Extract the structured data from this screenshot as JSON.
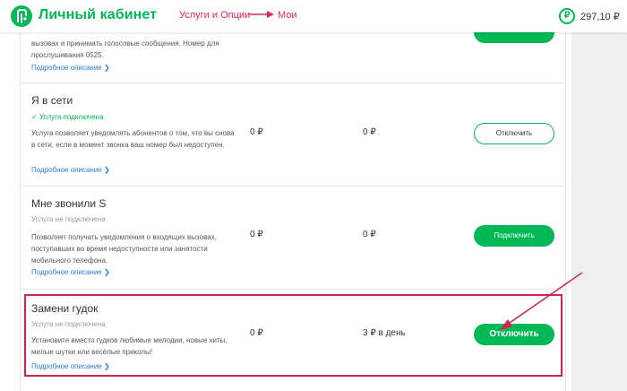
{
  "header": {
    "brand": "Личный кабинет",
    "crumb_1": "Услуги и Опции",
    "crumb_2": "Мои",
    "balance": "297,10 ₽",
    "currency_symbol": "₽",
    "accent_color": "#00b956",
    "annotation_color": "#e0245e"
  },
  "services": [
    {
      "title": "",
      "status": "",
      "description": "вызовах и принимать голосовые сообщения. Номер для прослушивания 0525.",
      "more_link": "Подробное описание ❯",
      "price_1": "",
      "price_2": "",
      "button": ""
    },
    {
      "title": "Я в сети",
      "status": "✓ Услуга подключена",
      "description": "Услуга позволяет уведомлять абонентов о том, что вы снова в сети, если в момент звонка ваш номер был недоступен.",
      "more_link": "Подробное описание ❯",
      "price_1": "0 ₽",
      "price_2": "0 ₽",
      "button": "Отключить"
    },
    {
      "title": "Мне звонили S",
      "status": "Услуга не подключена",
      "description": "Позволяет получать уведомления о входящих вызовах, поступавших во время недоступности или занятости мобильного телефона.",
      "more_link": "Подробное описание ❯",
      "price_1": "0 ₽",
      "price_2": "0 ₽",
      "button": "Подключить"
    },
    {
      "title": "Замени гудок",
      "status": "Услуга не подключена",
      "description": "Установите вместо гудков любимые мелодии, новые хиты, милые шутки или весёлые приколы!",
      "more_link": "Подробное описание ❯",
      "price_1": "0 ₽",
      "price_2": "3 ₽ в день",
      "button": "Отключить"
    }
  ]
}
